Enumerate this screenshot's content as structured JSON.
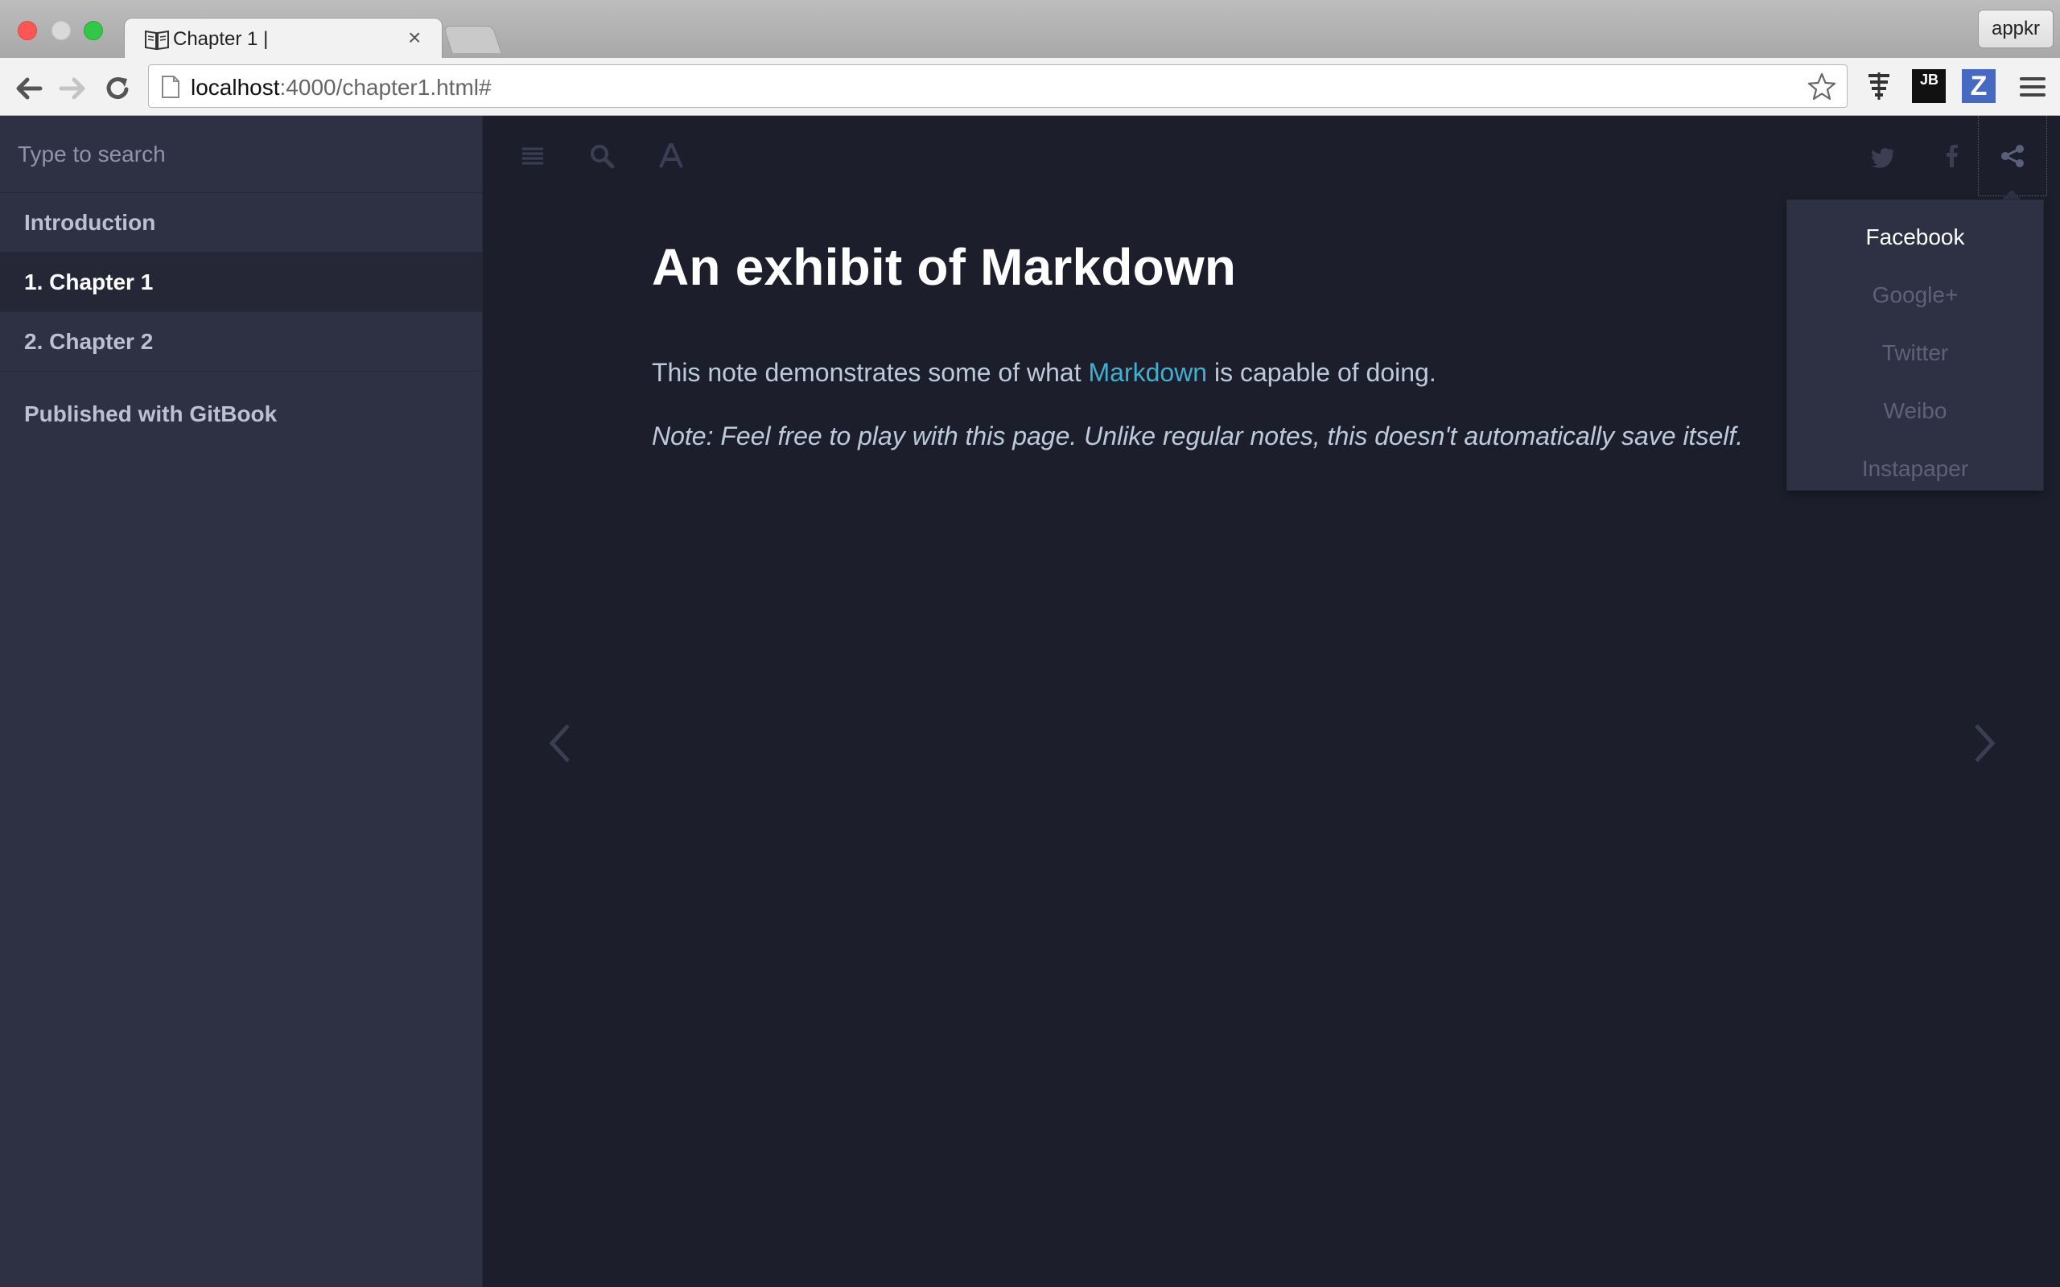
{
  "browser": {
    "tab_title": "Chapter 1 |",
    "tab_close": "×",
    "profile_label": "appkr",
    "url_host": "localhost",
    "url_rest": ":4000/chapter1.html#",
    "extensions": {
      "jb_label": "JB",
      "z_label": "Z"
    }
  },
  "sidebar": {
    "search_placeholder": "Type to search",
    "items": [
      {
        "label": "Introduction",
        "active": false
      },
      {
        "label": "1. Chapter 1",
        "active": true
      },
      {
        "label": "2. Chapter 2",
        "active": false
      }
    ],
    "published": "Published with GitBook"
  },
  "share_menu": {
    "items": [
      "Facebook",
      "Google+",
      "Twitter",
      "Weibo",
      "Instapaper"
    ]
  },
  "content": {
    "title": "An exhibit of Markdown",
    "para_before_link": "This note demonstrates some of what ",
    "link_text": "Markdown",
    "para_after_link": " is capable of doing.",
    "note": "Note: Feel free to play with this page. Unlike regular notes, this doesn't automatically save itself."
  },
  "colors": {
    "sidebar_bg": "#2d3143",
    "body_bg": "#1c1f2b",
    "link": "#3eb1d0"
  }
}
